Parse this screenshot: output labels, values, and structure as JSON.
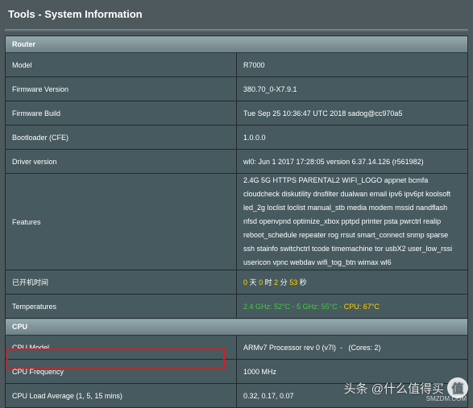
{
  "header": {
    "title": "Tools - System Information"
  },
  "router": {
    "section_title": "Router",
    "rows": [
      {
        "label": "Model",
        "value": "R7000"
      },
      {
        "label": "Firmware Version",
        "value": "380.70_0-X7.9.1"
      },
      {
        "label": "Firmware Build",
        "value": "Tue Sep 25 10:36:47 UTC 2018 sadog@cc970a5"
      },
      {
        "label": "Bootloader (CFE)",
        "value": "1.0.0.0"
      },
      {
        "label": "Driver version",
        "value": "wl0: Jun 1 2017 17:28:05 version 6.37.14.126 (r561982)"
      }
    ],
    "features": {
      "label": "Features",
      "value": "2.4G 5G HTTPS PARENTAL2 WIFI_LOGO appnet bcmfa cloudcheck diskutility dnsfilter dualwan email ipv6 ipv6pt koolsoft led_2g loclist loclist manual_stb media modem mssid nandflash nfsd openvpnd optimize_xbox pptpd printer psta pwrctrl realip reboot_schedule repeater rog rrsut smart_connect snmp sparse ssh stainfo switchctrl tcode timemachine tor usbX2 user_low_rssi usericon vpnc webdav wifi_tog_btn wimax wl6"
    },
    "uptime": {
      "label": "已开机时间",
      "days": "0",
      "days_unit": "天",
      "hours": "0",
      "hours_unit": "时",
      "minutes": "2",
      "minutes_unit": "分",
      "seconds": "53",
      "seconds_unit": "秒"
    },
    "temperatures": {
      "label": "Temperatures",
      "wifi24": "2.4 GHz: 52°C",
      "sep1": " - ",
      "wifi5": "5 GHz: 55°C",
      "sep2": " - ",
      "cpu": "CPU: 67°C"
    }
  },
  "cpu": {
    "section_title": "CPU",
    "rows": [
      {
        "label": "CPU Model",
        "value": "ARMv7 Processor rev 0 (v7l)  -   (Cores: 2)"
      },
      {
        "label": "CPU Frequency",
        "value": "1000 MHz"
      },
      {
        "label": "CPU Load Average (1, 5, 15 mins)",
        "value": "0.32, 0.17, 0.07"
      }
    ]
  },
  "watermark": {
    "logo_char": "值",
    "text": "头条 @什么值得买",
    "sub": "SMZDM.COM"
  },
  "colors": {
    "background": "#4d595d",
    "row_background": "#475a5f",
    "uptime_number": "#ffd500",
    "temp_green": "#45c847",
    "temp_cpu": "#ffd500",
    "highlight": "#e8161c"
  }
}
